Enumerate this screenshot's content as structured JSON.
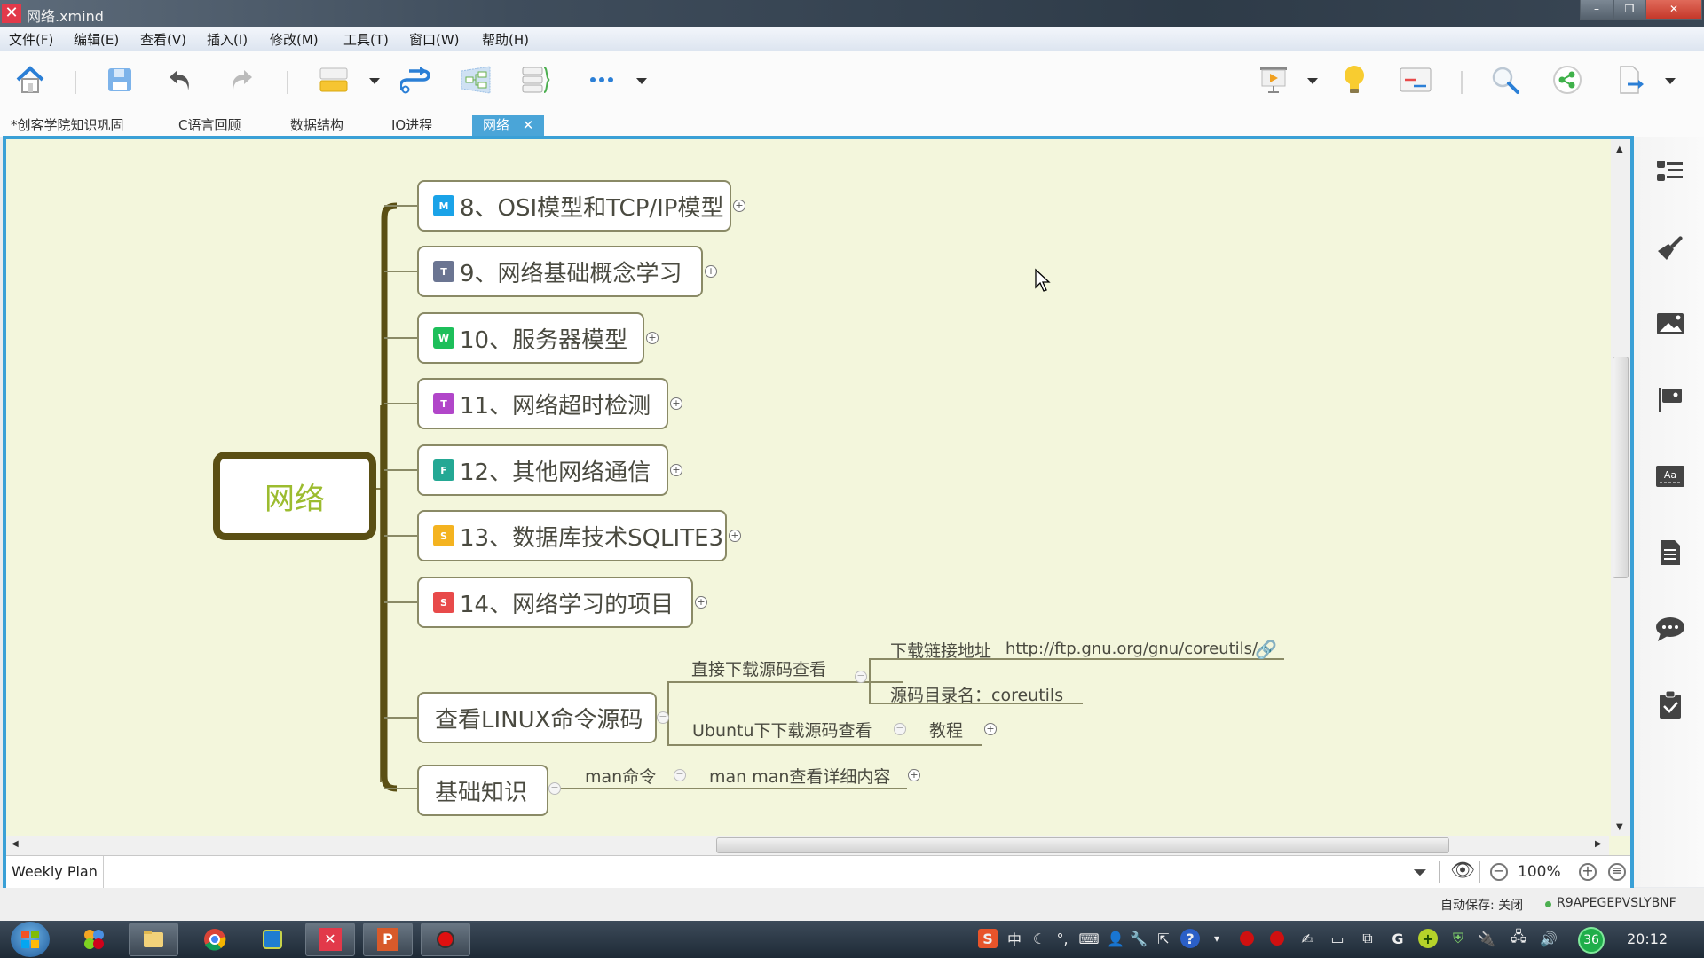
{
  "window": {
    "title": "网络.xmind",
    "minimize": "–",
    "restore": "❐",
    "close": "✕"
  },
  "menu": [
    "文件(F)",
    "编辑(E)",
    "查看(V)",
    "插入(I)",
    "修改(M)",
    "工具(T)",
    "窗口(W)",
    "帮助(H)"
  ],
  "toolbar": {
    "icons": [
      "home-icon",
      "save-icon",
      "undo-icon",
      "redo-icon",
      "topic-style-icon",
      "relationship-icon",
      "structure-icon",
      "summary-icon",
      "more-icon",
      "presentation-icon",
      "brainstorm-icon",
      "gantt-icon",
      "search-icon",
      "share-icon",
      "export-icon"
    ]
  },
  "tabs": [
    {
      "label": "*创客学院知识巩固",
      "active": false
    },
    {
      "label": "C语言回顾",
      "active": false
    },
    {
      "label": "数据结构",
      "active": false
    },
    {
      "label": "IO进程",
      "active": false
    },
    {
      "label": "网络",
      "active": true,
      "close": "✕"
    }
  ],
  "mindmap": {
    "central": "网络",
    "topics": [
      {
        "marker": "M",
        "marker_color": "#1aa3e8",
        "label": "8、OSI模型和TCP/IP模型",
        "collapsed": true
      },
      {
        "marker": "T",
        "marker_color": "#6b7592",
        "label": "9、网络基础概念学习",
        "collapsed": true
      },
      {
        "marker": "W",
        "marker_color": "#1dbf5a",
        "label": "10、服务器模型",
        "collapsed": true
      },
      {
        "marker": "T",
        "marker_color": "#b146c9",
        "label": "11、网络超时检测",
        "collapsed": true
      },
      {
        "marker": "F",
        "marker_color": "#24a894",
        "label": "12、其他网络通信",
        "collapsed": true
      },
      {
        "marker": "S",
        "marker_color": "#f4b320",
        "label": "13、数据库技术SQLITE3",
        "collapsed": true
      },
      {
        "marker": "S",
        "marker_color": "#e84a4a",
        "label": "14、网络学习的项目",
        "collapsed": true
      },
      {
        "label": "查看LINUX命令源码",
        "collapsed": false,
        "children": [
          {
            "label": "直接下载源码查看",
            "children": [
              {
                "label": "下载链接地址",
                "link": "http://ftp.gnu.org/gnu/coreutils/"
              },
              {
                "label": "源码目录名：coreutils"
              }
            ]
          },
          {
            "label": "Ubuntu下下载源码查看",
            "children": [
              {
                "label": "教程",
                "collapsed": true
              }
            ]
          }
        ]
      },
      {
        "label": "基础知识",
        "collapsed": false,
        "children": [
          {
            "label": "man命令",
            "children": [
              {
                "label": "man man查看详细内容",
                "collapsed": true
              }
            ]
          }
        ]
      }
    ]
  },
  "sheet_tab": "Weekly Plan",
  "zoom": {
    "level": "100%"
  },
  "status": {
    "autosave": "自动保存: 关闭",
    "account": "R9APEGEPVSLYBNF"
  },
  "taskbar": {
    "apps": [
      "start",
      "app-launcher",
      "file-explorer",
      "chrome",
      "virtualbox",
      "xmind",
      "wps-presentation",
      "recorder"
    ],
    "battery_badge": "36",
    "clock": "20:12",
    "ime": "中"
  },
  "colors": {
    "accent": "#3aa0d6",
    "canvas": "#f3f6dc",
    "branch": "#5a4f14",
    "central_text": "#9cbc2f"
  }
}
